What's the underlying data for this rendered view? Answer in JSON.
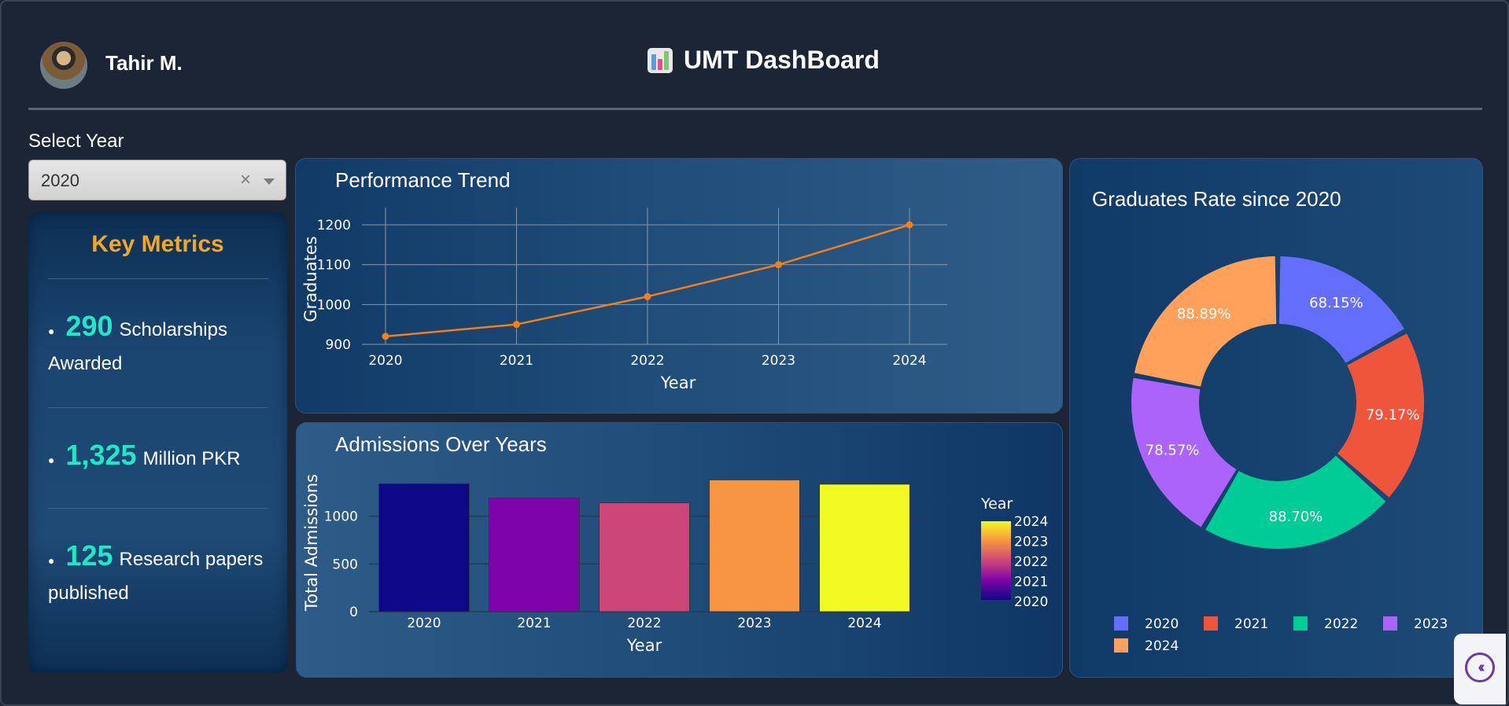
{
  "header": {
    "user_name": "Tahir M.",
    "app_title": "UMT DashBoard"
  },
  "filter": {
    "label": "Select Year",
    "selected": "2020",
    "clear_icon": "×"
  },
  "metrics": {
    "title": "Key Metrics",
    "items": [
      {
        "value": "290",
        "label": "Scholarships Awarded"
      },
      {
        "value": "1,325",
        "label": "Million PKR"
      },
      {
        "value": "125",
        "label": "Research papers published"
      }
    ]
  },
  "colors": {
    "accent_orange": "#f5a623",
    "metric_teal": "#1de9c9",
    "line": "#f57f17",
    "background": "#1c2535"
  },
  "chart_data": [
    {
      "type": "line",
      "title": "Performance Trend",
      "xlabel": "Year",
      "ylabel": "Graduates",
      "x": [
        2020,
        2021,
        2022,
        2023,
        2024
      ],
      "y": [
        920,
        950,
        1020,
        1100,
        1200
      ],
      "ylim": [
        900,
        1225
      ],
      "yticks": [
        900,
        1000,
        1100,
        1200
      ],
      "grid": true
    },
    {
      "type": "bar",
      "title": "Admissions Over Years",
      "xlabel": "Year",
      "ylabel": "Total Admissions",
      "categories": [
        "2020",
        "2021",
        "2022",
        "2023",
        "2024"
      ],
      "values": [
        1340,
        1190,
        1140,
        1380,
        1335
      ],
      "colors": [
        "#0d0887",
        "#7e03a8",
        "#cc4778",
        "#f89540",
        "#f0f921"
      ],
      "ylim": [
        0,
        1400
      ],
      "yticks": [
        0,
        500,
        1000
      ],
      "colorbar": {
        "title": "Year",
        "ticks": [
          "2024",
          "2023",
          "2022",
          "2021",
          "2020"
        ]
      },
      "grid": true
    },
    {
      "type": "pie",
      "title": "Graduates Rate since 2020",
      "hole": true,
      "labels": [
        "2020",
        "2021",
        "2022",
        "2023",
        "2024"
      ],
      "values": [
        68.15,
        79.17,
        88.7,
        78.57,
        88.89
      ],
      "display": [
        "68.15%",
        "79.17%",
        "88.70%",
        "78.57%",
        "88.89%"
      ],
      "colors": [
        "#636efa",
        "#ef553b",
        "#00cc96",
        "#ab63fa",
        "#ffa15a"
      ],
      "legend_position": "bottom"
    }
  ]
}
